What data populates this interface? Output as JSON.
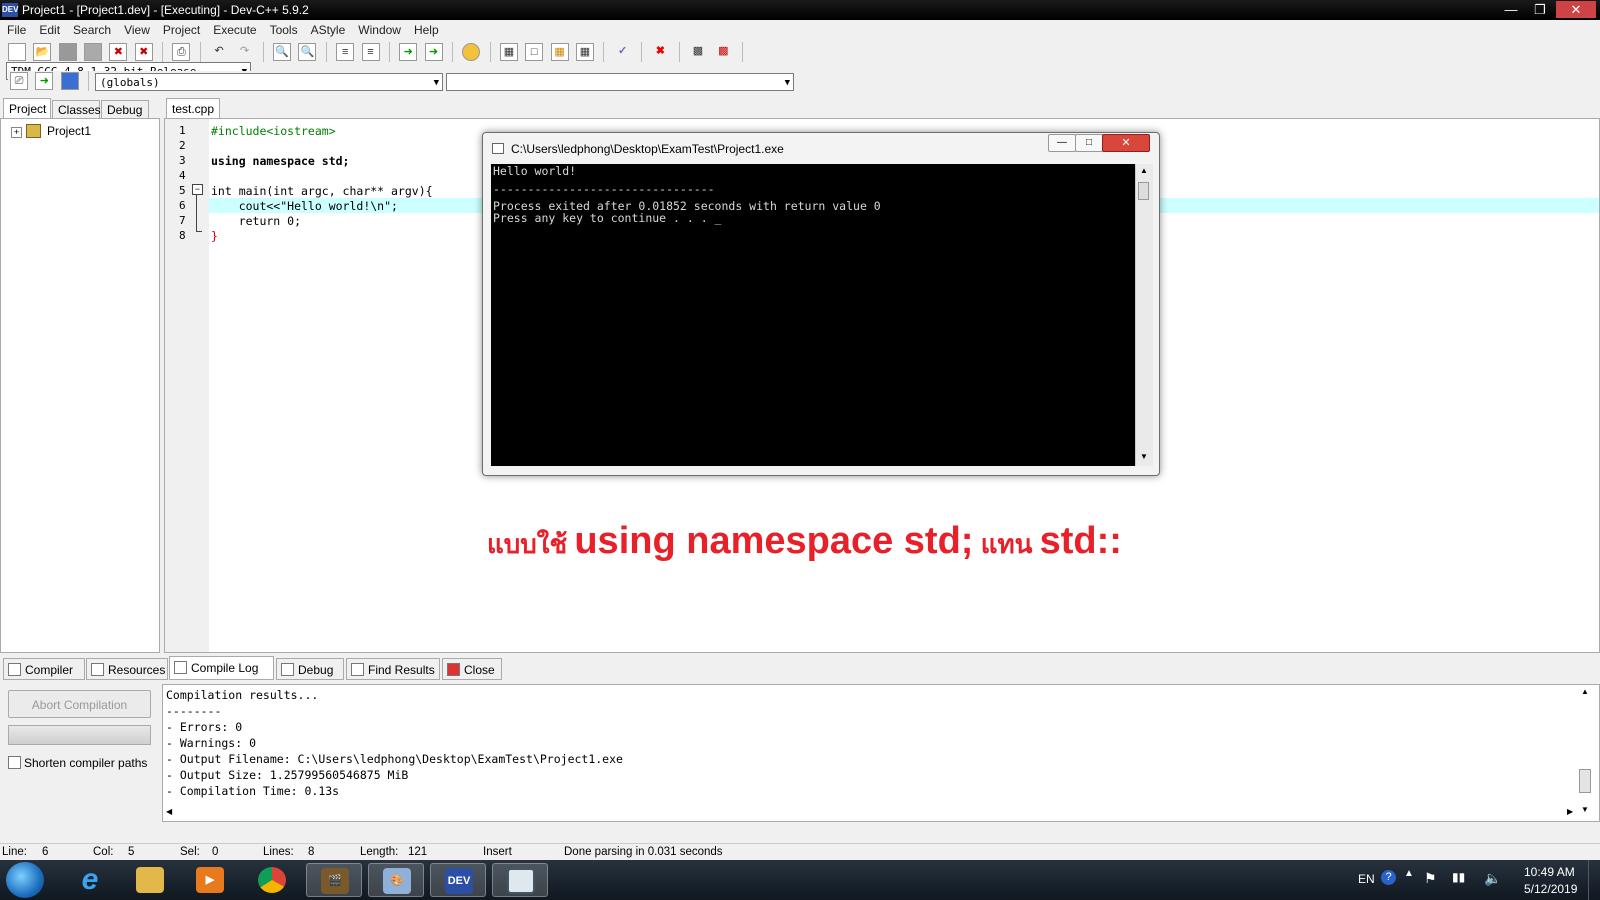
{
  "window": {
    "title": "Project1 - [Project1.dev] - [Executing] - Dev-C++ 5.9.2",
    "app_icon": "DEV"
  },
  "menu": [
    "File",
    "Edit",
    "Search",
    "View",
    "Project",
    "Execute",
    "Tools",
    "AStyle",
    "Window",
    "Help"
  ],
  "toolbar": {
    "compiler_select": "TDM-GCC 4.8.1 32-bit Release",
    "scope_select": "(globals)",
    "member_select": ""
  },
  "left_tabs": [
    "Project",
    "Classes",
    "Debug"
  ],
  "project_tree": {
    "root": "Project1"
  },
  "editor": {
    "tab": "test.cpp",
    "lines": [
      {
        "no": "1",
        "code": "#include<iostream>"
      },
      {
        "no": "2",
        "code": ""
      },
      {
        "no": "3",
        "code": "using namespace std;"
      },
      {
        "no": "4",
        "code": ""
      },
      {
        "no": "5",
        "code": "int main(int argc, char** argv){"
      },
      {
        "no": "6",
        "code": "    cout<<\"Hello world!\\n\";"
      },
      {
        "no": "7",
        "code": "    return 0;"
      },
      {
        "no": "8",
        "code": "}"
      }
    ]
  },
  "console": {
    "title": "C:\\Users\\ledphong\\Desktop\\ExamTest\\Project1.exe",
    "lines": [
      "Hello world!",
      "",
      "--------------------------------",
      "Process exited after 0.01852 seconds with return value 0",
      "Press any key to continue . . . _"
    ]
  },
  "caption": {
    "part1": "แบบใช้ ",
    "part2": "using namespace std;",
    "part3": " แทน ",
    "part4": "std::"
  },
  "bottom_tabs": [
    "Compiler",
    "Resources",
    "Compile Log",
    "Debug",
    "Find Results",
    "Close"
  ],
  "compile": {
    "abort_label": "Abort Compilation",
    "shorten_label": "Shorten compiler paths",
    "log": [
      "Compilation results...",
      "--------",
      "- Errors: 0",
      "- Warnings: 0",
      "- Output Filename: C:\\Users\\ledphong\\Desktop\\ExamTest\\Project1.exe",
      "- Output Size: 1.25799560546875 MiB",
      "- Compilation Time: 0.13s"
    ]
  },
  "status": {
    "line_label": "Line:",
    "line": "6",
    "col_label": "Col:",
    "col": "5",
    "sel_label": "Sel:",
    "sel": "0",
    "lines_label": "Lines:",
    "lines": "8",
    "length_label": "Length:",
    "length": "121",
    "mode": "Insert",
    "message": "Done parsing in 0.031 seconds"
  },
  "taskbar": {
    "lang": "EN",
    "time": "10:49 AM",
    "date": "5/12/2019",
    "apps": [
      "internet-explorer",
      "file-explorer",
      "media-player",
      "chrome",
      "video-editor",
      "paint",
      "dev-cpp",
      "console-app"
    ]
  }
}
